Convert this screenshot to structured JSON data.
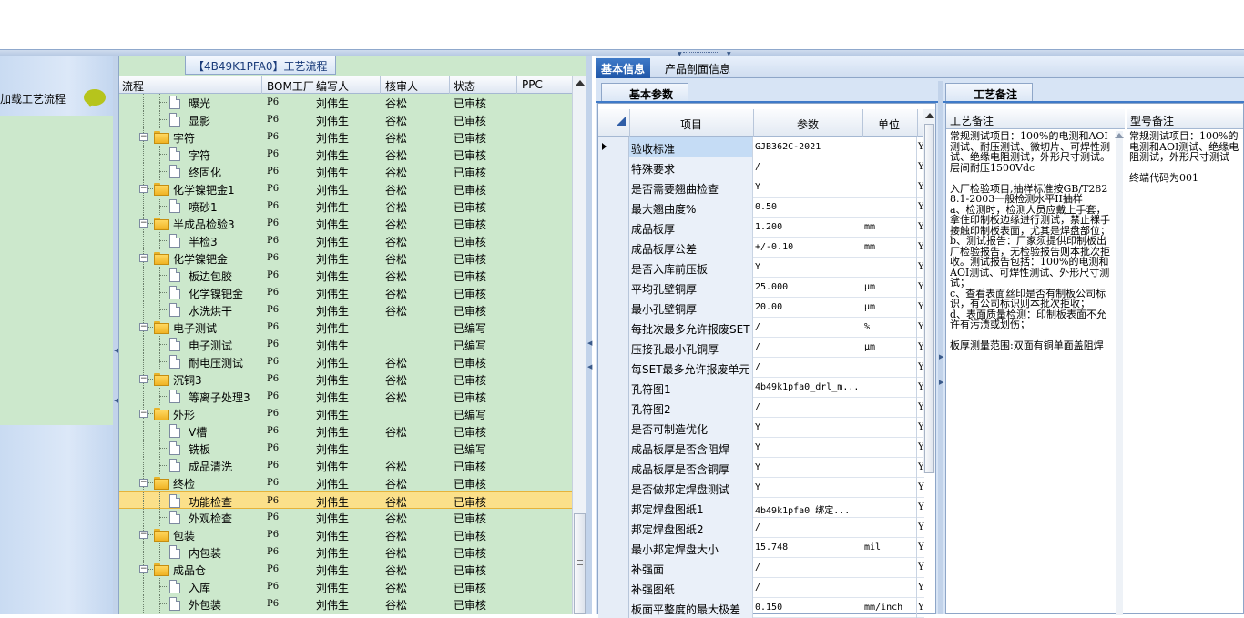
{
  "left_panel": {
    "item_label": "加载工艺流程"
  },
  "process": {
    "caption": "【4B49K1PFA0】工艺流程",
    "headers": [
      "流程",
      "BOM工厂",
      "编写人",
      "核审人",
      "状态",
      "PPC"
    ],
    "rows": [
      {
        "name": "曝光",
        "level": 2,
        "bom": "P6",
        "writer": "刘伟生",
        "checker": "谷松",
        "status": "已审核"
      },
      {
        "name": "显影",
        "level": 2,
        "bom": "P6",
        "writer": "刘伟生",
        "checker": "谷松",
        "status": "已审核"
      },
      {
        "name": "字符",
        "level": 1,
        "bom": "P6",
        "writer": "刘伟生",
        "checker": "谷松",
        "status": "已审核"
      },
      {
        "name": "字符",
        "level": 2,
        "bom": "P6",
        "writer": "刘伟生",
        "checker": "谷松",
        "status": "已审核"
      },
      {
        "name": "终固化",
        "level": 2,
        "bom": "P6",
        "writer": "刘伟生",
        "checker": "谷松",
        "status": "已审核"
      },
      {
        "name": "化学镍钯金1",
        "level": 1,
        "bom": "P6",
        "writer": "刘伟生",
        "checker": "谷松",
        "status": "已审核"
      },
      {
        "name": "喷砂1",
        "level": 2,
        "bom": "P6",
        "writer": "刘伟生",
        "checker": "谷松",
        "status": "已审核"
      },
      {
        "name": "半成品检验3",
        "level": 1,
        "bom": "P6",
        "writer": "刘伟生",
        "checker": "谷松",
        "status": "已审核"
      },
      {
        "name": "半检3",
        "level": 2,
        "bom": "P6",
        "writer": "刘伟生",
        "checker": "谷松",
        "status": "已审核"
      },
      {
        "name": "化学镍钯金",
        "level": 1,
        "bom": "P6",
        "writer": "刘伟生",
        "checker": "谷松",
        "status": "已审核"
      },
      {
        "name": "板边包胶",
        "level": 2,
        "bom": "P6",
        "writer": "刘伟生",
        "checker": "谷松",
        "status": "已审核"
      },
      {
        "name": "化学镍钯金",
        "level": 2,
        "bom": "P6",
        "writer": "刘伟生",
        "checker": "谷松",
        "status": "已审核"
      },
      {
        "name": "水洗烘干",
        "level": 2,
        "bom": "P6",
        "writer": "刘伟生",
        "checker": "谷松",
        "status": "已审核"
      },
      {
        "name": "电子测试",
        "level": 1,
        "bom": "P6",
        "writer": "刘伟生",
        "checker": "",
        "status": "已编写"
      },
      {
        "name": "电子测试",
        "level": 2,
        "bom": "P6",
        "writer": "刘伟生",
        "checker": "",
        "status": "已编写"
      },
      {
        "name": "耐电压测试",
        "level": 2,
        "bom": "P6",
        "writer": "刘伟生",
        "checker": "谷松",
        "status": "已审核"
      },
      {
        "name": "沉铜3",
        "level": 1,
        "bom": "P6",
        "writer": "刘伟生",
        "checker": "谷松",
        "status": "已审核"
      },
      {
        "name": "等离子处理3",
        "level": 2,
        "bom": "P6",
        "writer": "刘伟生",
        "checker": "谷松",
        "status": "已审核"
      },
      {
        "name": "外形",
        "level": 1,
        "bom": "P6",
        "writer": "刘伟生",
        "checker": "",
        "status": "已编写"
      },
      {
        "name": "V槽",
        "level": 2,
        "bom": "P6",
        "writer": "刘伟生",
        "checker": "谷松",
        "status": "已审核"
      },
      {
        "name": "铣板",
        "level": 2,
        "bom": "P6",
        "writer": "刘伟生",
        "checker": "",
        "status": "已编写"
      },
      {
        "name": "成品清洗",
        "level": 2,
        "bom": "P6",
        "writer": "刘伟生",
        "checker": "谷松",
        "status": "已审核"
      },
      {
        "name": "终检",
        "level": 1,
        "bom": "P6",
        "writer": "刘伟生",
        "checker": "谷松",
        "status": "已审核"
      },
      {
        "name": "功能检查",
        "level": 2,
        "bom": "P6",
        "writer": "刘伟生",
        "checker": "谷松",
        "status": "已审核",
        "selected": true
      },
      {
        "name": "外观检查",
        "level": 2,
        "bom": "P6",
        "writer": "刘伟生",
        "checker": "谷松",
        "status": "已审核"
      },
      {
        "name": "包装",
        "level": 1,
        "bom": "P6",
        "writer": "刘伟生",
        "checker": "谷松",
        "status": "已审核"
      },
      {
        "name": "内包装",
        "level": 2,
        "bom": "P6",
        "writer": "刘伟生",
        "checker": "谷松",
        "status": "已审核"
      },
      {
        "name": "成品仓",
        "level": 1,
        "bom": "P6",
        "writer": "刘伟生",
        "checker": "谷松",
        "status": "已审核"
      },
      {
        "name": "入库",
        "level": 2,
        "bom": "P6",
        "writer": "刘伟生",
        "checker": "谷松",
        "status": "已审核"
      },
      {
        "name": "外包装",
        "level": 2,
        "bom": "P6",
        "writer": "刘伟生",
        "checker": "谷松",
        "status": "已审核"
      }
    ]
  },
  "tabs": {
    "basic_info": "基本信息",
    "profile_info": "产品剖面信息"
  },
  "params": {
    "tab": "基本参数",
    "headers": [
      "项目",
      "参数",
      "单位"
    ],
    "rows": [
      {
        "k": "验收标准",
        "v": "GJB362C-2021",
        "u": "",
        "y": "Y"
      },
      {
        "k": "特殊要求",
        "v": "/",
        "u": "",
        "y": "Y"
      },
      {
        "k": "是否需要翘曲检查",
        "v": "Y",
        "u": "",
        "y": "Y"
      },
      {
        "k": "最大翘曲度%",
        "v": "0.50",
        "u": "",
        "y": "Y"
      },
      {
        "k": "成品板厚",
        "v": "1.200",
        "u": "mm",
        "y": "Y"
      },
      {
        "k": "成品板厚公差",
        "v": "+/-0.10",
        "u": "mm",
        "y": "Y"
      },
      {
        "k": "是否入库前压板",
        "v": "Y",
        "u": "",
        "y": "Y"
      },
      {
        "k": "平均孔壁铜厚",
        "v": "25.000",
        "u": "μm",
        "y": "Y"
      },
      {
        "k": "最小孔壁铜厚",
        "v": "20.00",
        "u": "μm",
        "y": "Y"
      },
      {
        "k": "每批次最多允许报废SET",
        "v": "/",
        "u": "%",
        "y": "Y"
      },
      {
        "k": "压接孔最小孔铜厚",
        "v": "/",
        "u": "μm",
        "y": "Y"
      },
      {
        "k": "每SET最多允许报废单元",
        "v": "/",
        "u": "",
        "y": "Y"
      },
      {
        "k": "孔符图1",
        "v": "4b49k1pfa0_drl_m...",
        "u": "",
        "y": "Y"
      },
      {
        "k": "孔符图2",
        "v": "/",
        "u": "",
        "y": "Y"
      },
      {
        "k": "是否可制造优化",
        "v": "Y",
        "u": "",
        "y": "Y"
      },
      {
        "k": "成品板厚是否含阻焊",
        "v": "Y",
        "u": "",
        "y": "Y"
      },
      {
        "k": "成品板厚是否含铜厚",
        "v": "Y",
        "u": "",
        "y": "Y"
      },
      {
        "k": "是否做邦定焊盘测试",
        "v": "Y",
        "u": "",
        "y": "Y"
      },
      {
        "k": "邦定焊盘图纸1",
        "v": "4b49k1pfa0 绑定...",
        "u": "",
        "y": "Y"
      },
      {
        "k": "邦定焊盘图纸2",
        "v": "/",
        "u": "",
        "y": "Y"
      },
      {
        "k": "最小邦定焊盘大小",
        "v": "15.748",
        "u": "mil",
        "y": "Y"
      },
      {
        "k": "补强面",
        "v": "/",
        "u": "",
        "y": "Y"
      },
      {
        "k": "补强图纸",
        "v": "/",
        "u": "",
        "y": "Y"
      },
      {
        "k": "板面平整度的最大极差",
        "v": "0.150",
        "u": "mm/inch",
        "y": "Y"
      }
    ]
  },
  "notes": {
    "tab": "工艺备注",
    "process_note_header": "工艺备注",
    "model_note_header": "型号备注",
    "process_note": "常规测试项目：100%的电测和AOI测试、耐压测试、微切片、可焊性测试、绝缘电阻测试，外形尺寸测试。层间耐压1500Vdc\n\n入厂检验项目,抽样标准按GB/T2828.1-2003一般检测水平II抽样\na、检测时，检测人员应戴上手套，拿住印制板边缘进行测试，禁止裸手接触印制板表面，尤其是焊盘部位；\nb、测试报告：厂家须提供印制板出厂检验报告，无检验报告则本批次拒收。测试报告包括：100%的电测和AOI测试、可焊性测试、外形尺寸测试；\nc、查看表面丝印是否有制板公司标识，有公司标识则本批次拒收；\nd、表面质量检测：印制板表面不允许有污渍或划伤；\n\n板厚测量范围:双面有铜单面盖阻焊",
    "model_note": "常规测试项目：100%的电测和AOI测试、绝缘电阻测试，外形尺寸测试\n\n终端代码为001"
  }
}
